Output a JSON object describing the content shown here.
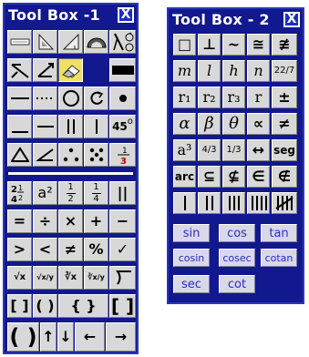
{
  "toolbox1": {
    "title": "Tool Box -1",
    "close_label": "X",
    "geometry_rows": [
      [
        "line-segment-icon",
        "triangle-ruler-icon",
        "set-square-icon",
        "protractor-icon",
        "compass-icon"
      ],
      [
        "angle-icon",
        "ray-icon",
        "eraser-icon",
        "fill-rect-icon"
      ],
      [
        "horizontal-line-icon",
        "dotted-line-icon",
        "circle-icon",
        "rotate-icon",
        "dot-icon"
      ],
      [
        "underscore-icon",
        "vertical-line-icon",
        "double-bar-icon",
        "vertical-bar-icon",
        "degree-45-icon"
      ],
      [
        "triangle-icon",
        "angle-mark-icon",
        "dots-triangle-icon",
        "dots-square-icon",
        "fraction-bar-icon"
      ]
    ],
    "degree_label": "45",
    "fraction_1_3_label": "1/3",
    "symbols": {
      "mixed_fraction": "2 1/4 2",
      "square": "a²",
      "half_num": "1",
      "half_den": "2",
      "quarter_num": "1",
      "quarter_den": "4",
      "parallel": "||",
      "equals": "=",
      "divide": "÷",
      "times": "×",
      "plus": "+",
      "minus": "−",
      "greater": ">",
      "less": "<",
      "not_equal": "≠",
      "percent": "%",
      "check": "✓",
      "sqrt": "√x",
      "sqrt_frac": "√x/y",
      "cbrt": "∛x",
      "cbrt_frac": "∛x/y",
      "bracket_square": "[ ]",
      "bracket_round": "( )",
      "bracket_curly": "{ }",
      "bracket_square_large": "[ ]",
      "paren_large": "( )",
      "arrow_up": "↑",
      "arrow_down": "↓",
      "arrow_left": "←",
      "arrow_right": "→"
    }
  },
  "toolbox2": {
    "title": "Tool Box - 2",
    "close_label": "X",
    "row1": [
      "□",
      "⊥",
      "~",
      "≅",
      "≇"
    ],
    "row2": [
      "m",
      "l",
      "h",
      "n",
      "22/7"
    ],
    "row3": [
      "r₁",
      "r₂",
      "r₃",
      "r",
      "±"
    ],
    "row4": [
      "α",
      "β",
      "θ",
      "∝",
      "≠"
    ],
    "row5_a3": "a³",
    "row5_f1": "4/3",
    "row5_f2": "1/3",
    "row5_arrow": "↔",
    "row5_seg": "seg",
    "row6": [
      "arc",
      "⊆",
      "⊈",
      "∈",
      "∉"
    ],
    "fn_buttons": [
      "sin",
      "cos",
      "tan",
      "cosin",
      "cosec",
      "cotan",
      "sec",
      "cot"
    ]
  },
  "colors": {
    "panel_bg": "#12188e",
    "button_bg": "#d8d8d8",
    "fn_text": "#2a2ad0"
  }
}
